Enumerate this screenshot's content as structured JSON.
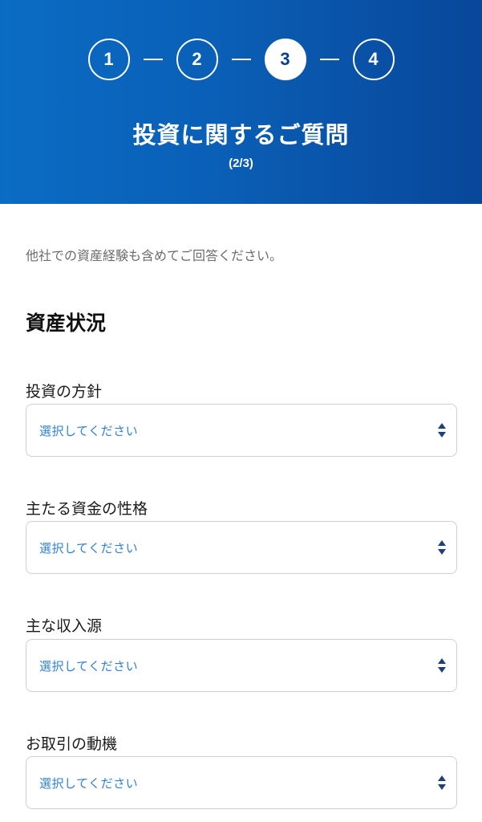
{
  "header": {
    "steps": [
      {
        "label": "1",
        "active": false
      },
      {
        "label": "2",
        "active": false
      },
      {
        "label": "3",
        "active": true
      },
      {
        "label": "4",
        "active": false
      }
    ],
    "title": "投資に関するご質問",
    "progress": "(2/3)"
  },
  "main": {
    "note": "他社での資産経験も含めてご回答ください。",
    "section_title": "資産状況",
    "fields": [
      {
        "label": "投資の方針",
        "value": "選択してください"
      },
      {
        "label": "主たる資金の性格",
        "value": "選択してください"
      },
      {
        "label": "主な収入源",
        "value": "選択してください"
      },
      {
        "label": "お取引の動機",
        "value": "選択してください"
      }
    ]
  },
  "colors": {
    "header_gradient_start": "#0b6cc4",
    "header_gradient_end": "#08479a",
    "active_step_text": "#0a3d91",
    "select_placeholder": "#2e7fd6",
    "select_arrows": "#1f3f7a"
  },
  "icons": {
    "select_arrows": "up-down-arrows-icon"
  }
}
